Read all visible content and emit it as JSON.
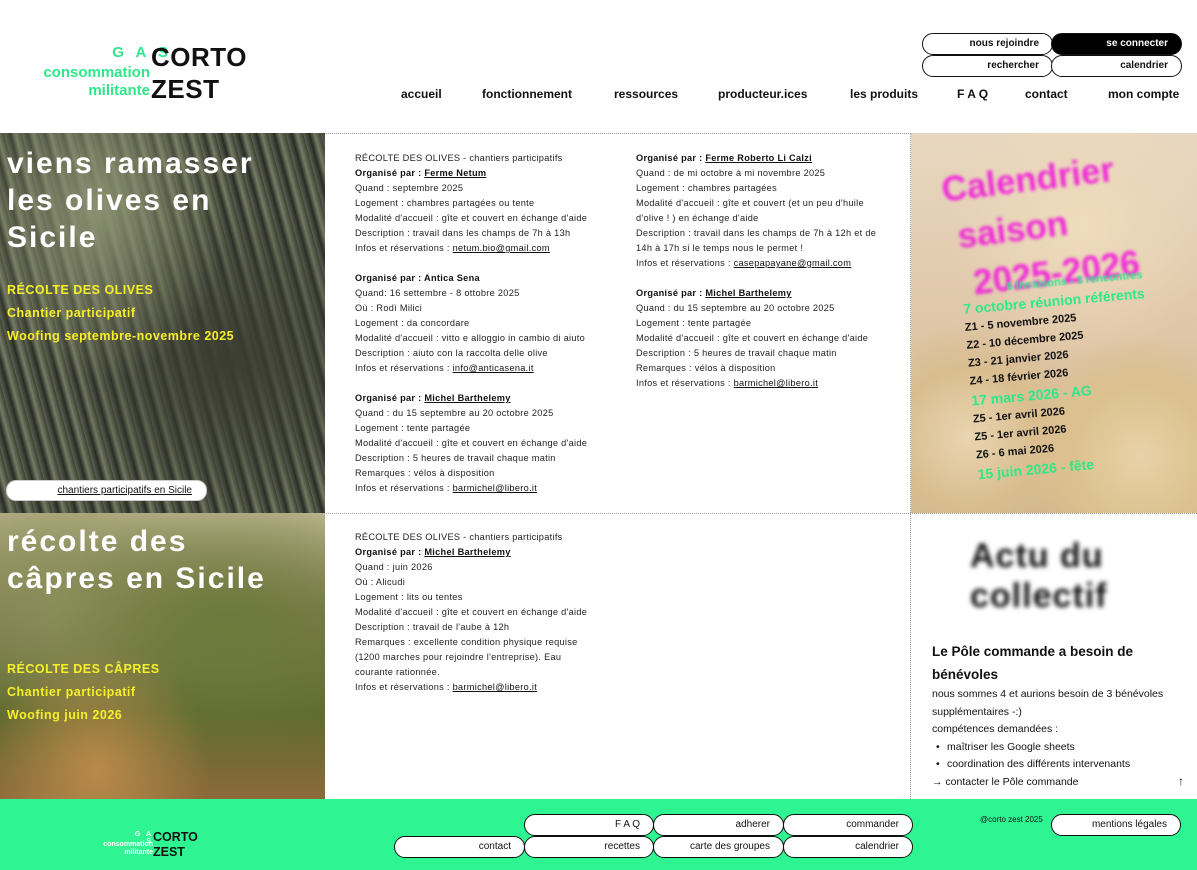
{
  "brand": {
    "gas": "G A S",
    "line1": "consommation",
    "line2": "militante",
    "corto": "CORTO",
    "zest": "ZEST"
  },
  "header_buttons": {
    "join": "nous rejoindre",
    "login": "se connecter",
    "search": "rechercher",
    "calendar": "calendrier"
  },
  "nav": [
    "accueil",
    "fonctionnement",
    "ressources",
    "producteur.ices",
    "les produits",
    "F A Q",
    "contact",
    "mon compte"
  ],
  "olives": {
    "title": [
      "viens ramasser",
      "les olives en",
      "Sicile"
    ],
    "tags": [
      "RÉCOLTE DES OLIVES",
      "Chantier participatif",
      "Woofing septembre-novembre 2025"
    ],
    "button": "chantiers participatifs en Sicile"
  },
  "olives_col1": {
    "header": "RÉCOLTE DES OLIVES - chantiers participatifs",
    "blocks": [
      {
        "org_label": "Organisé par : ",
        "org_name": "Ferme Netum",
        "lines": [
          "Quand : septembre 2025",
          "Logement : chambres partagées ou tente",
          "Modalité d'accueil : gîte et couvert en échange d'aide",
          "Description : travail dans les champs de 7h à 13h"
        ],
        "contact_label": "Infos et réservations : ",
        "contact": "netum.bio@gmail.com"
      },
      {
        "org_label": "Organisé par : ",
        "org_name": "Antica Sena",
        "lines": [
          "Quand: 16 settembre - 8 ottobre 2025",
          "Où : Rodì Milici",
          "Logement : da concordare",
          "Modalité d'accueil : vitto e alloggio in cambio di aiuto",
          "Description : aiuto con la raccolta delle olive"
        ],
        "contact_label": "Infos et réservations : ",
        "contact": "info@anticasena.it"
      },
      {
        "org_label": "Organisé par : ",
        "org_name": "Michel Barthelemy",
        "lines": [
          "Quand : du 15 septembre au 20 octobre 2025",
          "Logement : tente partagée",
          "Modalité d'accueil : gîte et couvert en échange d'aide",
          "Description : 5 heures de travail chaque matin",
          "Remarques : vélos à disposition"
        ],
        "contact_label": "Infos et réservations : ",
        "contact": "barmichel@libero.it"
      }
    ]
  },
  "olives_col2": {
    "blocks": [
      {
        "org_label": "Organisé par : ",
        "org_name": "Ferme Roberto Li Calzi",
        "lines": [
          "Quand :  de mi octobre à mi novembre 2025",
          "Logement :  chambres partagées",
          "Modalité d'accueil : gîte et couvert (et un peu d'huile",
          "d'olive ! ) en échange d'aide",
          "Description : travail dans les champs de 7h à 12h et de",
          "14h à 17h si le temps nous le permet !"
        ],
        "contact_label": "Infos et réservations : ",
        "contact": "casepapayane@gmail.com"
      },
      {
        "org_label": "Organisé par : ",
        "org_name": "Michel Barthelemy",
        "lines": [
          "Quand : du 15 septembre au 20 octobre 2025",
          "Logement : tente partagée",
          "Modalité d'accueil : gîte et couvert en échange d'aide",
          "Description : 5 heures de travail chaque matin",
          "Remarques : vélos à disposition"
        ],
        "contact_label": "Infos et réservations : ",
        "contact": "barmichel@libero.it"
      }
    ]
  },
  "calendar": {
    "title": [
      "Calendrier",
      "saison",
      "2025-2026"
    ],
    "subtitle": "6 livraisons - 3 rencontres",
    "referents": "7 octobre réunion référents",
    "z_dates": [
      "Z1 - 5 novembre 2025",
      "Z2 - 10 décembre 2025",
      "Z3 - 21 janvier 2026",
      "Z4 - 18 février 2026"
    ],
    "ag": "17 mars 2026 - AG",
    "z_dates2": [
      "Z5 - 1er avril 2026",
      "Z5 - 1er avril 2026",
      "Z6 - 6 mai 2026"
    ],
    "fete": "15 juin 2026 - fête"
  },
  "capres": {
    "title": [
      "récolte des",
      "câpres en Sicile"
    ],
    "tags": [
      "RÉCOLTE DES CÂPRES",
      "Chantier participatif",
      "Woofing juin 2026"
    ]
  },
  "capres_info": {
    "header": "RÉCOLTE DES OLIVES - chantiers participatifs",
    "org_label": "Organisé par :  ",
    "org_name": "Michel Barthelemy",
    "lines": [
      "Quand : juin 2026",
      "Où : Alicudi",
      "Logement : lits ou tentes",
      "Modalité d'accueil : gîte et couvert en échange d'aide",
      "Description : travail de l'aube à 12h",
      "Remarques : excellente condition physique requise",
      "(1200 marches pour rejoindre l'entreprise). Eau",
      "courante rationnée."
    ],
    "contact_label": "Infos et réservations : ",
    "contact": "barmichel@libero.it"
  },
  "actu": {
    "title": [
      "Actu du",
      "collectif"
    ],
    "heading": [
      "Le Pôle commande a besoin de",
      "bénévoles"
    ],
    "text": [
      "nous sommes 4 et aurions besoin de 3 bénévoles",
      "supplémentaires  -:)",
      "compétences demandées :"
    ],
    "skills": [
      "maîtriser les Google sheets",
      "coordination des différents intervenants"
    ],
    "link": "→ contacter le Pôle commande",
    "up": "↑"
  },
  "footer": {
    "links": {
      "faq": "F A Q",
      "adherer": "adherer",
      "commander": "commander",
      "contact": "contact",
      "recettes": "recettes",
      "carte": "carte des groupes",
      "calendrier": "calendrier"
    },
    "copyright": "@corto zest 2025",
    "legal": "mentions légales"
  },
  "colors": {
    "green": "#2ee88a",
    "footer_green": "#2ef592",
    "magenta": "#f02ad8",
    "yellow": "#f6f02a"
  }
}
